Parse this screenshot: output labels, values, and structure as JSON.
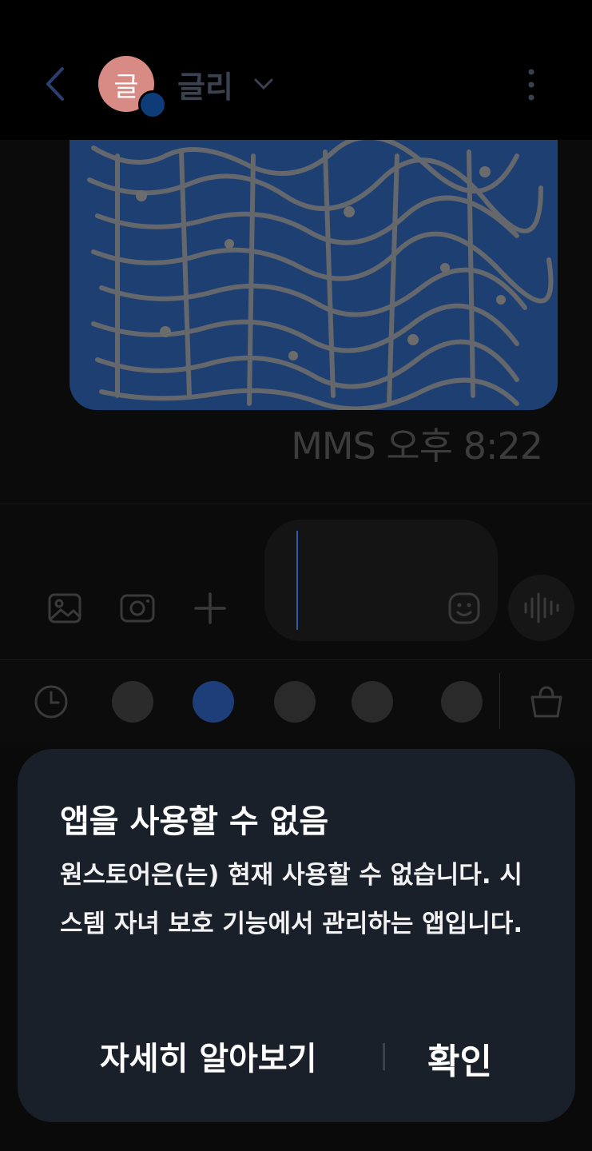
{
  "header": {
    "avatar_initial": "글",
    "contact_name": "글리"
  },
  "message": {
    "meta": "MMS 오후 8:22"
  },
  "compose": {
    "placeholder": ""
  },
  "dialog": {
    "title": "앱을 사용할 수 없음",
    "body": "원스토어은(는) 현재 사용할 수 없습니다. 시스템 자녀 보호 기능에서 관리하는 앱입니다.",
    "learn_more": "자세히 알아보기",
    "confirm": "확인"
  },
  "colors": {
    "background": "#000000",
    "bubble": "#1e3f72",
    "dialog": "#1a202a",
    "avatar": "#d88a84",
    "accent": "#2f5aa8"
  },
  "icons": [
    "back-icon",
    "more-icon",
    "gallery-icon",
    "camera-icon",
    "plus-icon",
    "emoji-icon",
    "voice-icon",
    "recent-icon",
    "basket-icon"
  ]
}
